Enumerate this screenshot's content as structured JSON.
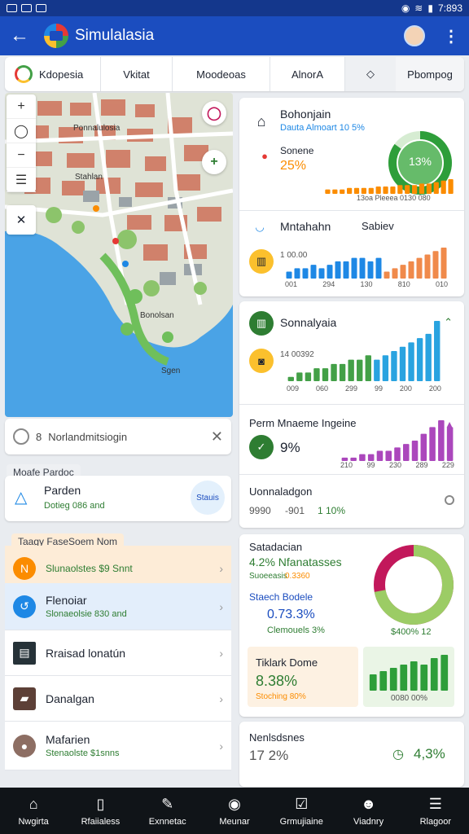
{
  "status_bar": {
    "time": "7:893"
  },
  "app_bar": {
    "title": "Simulalasia"
  },
  "tabs": [
    "Kdopesia",
    "Vkitat",
    "Moodeoas",
    "AlnorA",
    "Pbompog"
  ],
  "map": {
    "labels": [
      "Ponnalulosia",
      "Stahlan",
      "Bonolsan",
      "Sgen"
    ]
  },
  "search": {
    "value": "Norlandmitsiogin",
    "prefix": "8"
  },
  "section_label_1": "Moafe Pardoc",
  "parden_card": {
    "title": "Parden",
    "subtitle": "Dotieg 086 and",
    "badge": "Stauis"
  },
  "section_label_2": "Taagy FaseSoem Nom",
  "list": [
    {
      "title": "Slunaolstes $9 Snnt",
      "subtitle": "",
      "color": "#fb8c00"
    },
    {
      "title": "Flenoiar",
      "subtitle": "Slonaeolsie 830 and",
      "color": "#1e88e5"
    },
    {
      "title": "Rraisad lonatún",
      "subtitle": "",
      "color": "#263238"
    },
    {
      "title": "Danalgan",
      "subtitle": "",
      "color": "#5d4037"
    },
    {
      "title": "Mafarien",
      "subtitle": "Stenaolste $1snns",
      "color": "#8d6e63"
    }
  ],
  "card_bohonjain": {
    "title": "Bohonjain",
    "subtitle": "Dauta Almoart 10 5%",
    "label": "Sonene",
    "value": "25%",
    "donut_label": "13%",
    "donut_fraction": 0.85,
    "axis_text": "13oa Pleeea 0130 080",
    "bars": [
      3,
      3,
      3,
      4,
      4,
      4,
      4,
      5,
      5,
      5,
      6,
      6,
      6,
      7,
      7,
      8,
      9,
      10
    ]
  },
  "card_mntahahn": {
    "title": "Mntahahn",
    "badge": "Sabiev",
    "ylabel": "1 00.00",
    "xlabels": [
      "001",
      "294",
      "130",
      "810",
      "010"
    ],
    "bars_blue": [
      2,
      3,
      3,
      4,
      3,
      4,
      5,
      5,
      6,
      6,
      5,
      6
    ],
    "bars_orange": [
      2,
      3,
      4,
      5,
      6,
      7,
      8,
      9
    ]
  },
  "card_sonnalyaia": {
    "title": "Sonnalyaia",
    "ylabel": "14 00392",
    "xlabels": [
      "009",
      "060",
      "299",
      "99",
      "200",
      "200"
    ],
    "bars_green": [
      1,
      2,
      2,
      3,
      3,
      4,
      4,
      5,
      5,
      6
    ],
    "bars_blue": [
      5,
      6,
      7,
      8,
      9,
      10,
      11,
      14
    ]
  },
  "card_perm": {
    "title": "Perm Mnaeme Ingeine",
    "value": "9%",
    "xlabels": [
      "210",
      "99",
      "230",
      "289",
      "229"
    ],
    "bars": [
      1,
      1,
      2,
      2,
      3,
      3,
      4,
      5,
      6,
      8,
      10,
      12,
      10
    ]
  },
  "card_uonnaladgon": {
    "title": "Uonnaladgon",
    "stat1": "9990",
    "stat2": "-901",
    "stat3": "1 10%"
  },
  "card_satadacian": {
    "title": "Satadacian",
    "line1": "4.2% Nfanatasses",
    "line1_sub": "Suoeeasis",
    "line1_badge": "0.3360",
    "line2": "Staech Bodele",
    "line2_value": "0.73.3%",
    "line2_sub": "Clemouels 3%",
    "ring_label": "$400% 12",
    "ring_fraction": 0.72
  },
  "card_tiklark": {
    "title": "Tiklark Dome",
    "value": "8.38%",
    "sub": "Stoching 80%"
  },
  "card_minibar": {
    "caption": "0080 00%",
    "bars": [
      5,
      6,
      7,
      8,
      9,
      8,
      10,
      11
    ]
  },
  "card_nenlsdsnes": {
    "title": "Nenlsdsnes",
    "value": "17 2%",
    "right_value": "4,3%"
  },
  "bottom_nav": [
    "Nwgirta",
    "Rfaiialess",
    "Exnnetac",
    "Meunar",
    "Grmujiaine",
    "Viadnry",
    "Rlagoor"
  ],
  "colors": {
    "primary": "#1b4dbf",
    "green": "#43a047",
    "orange": "#fb8c00",
    "blue": "#1e88e5",
    "purple": "#ab47bc"
  }
}
